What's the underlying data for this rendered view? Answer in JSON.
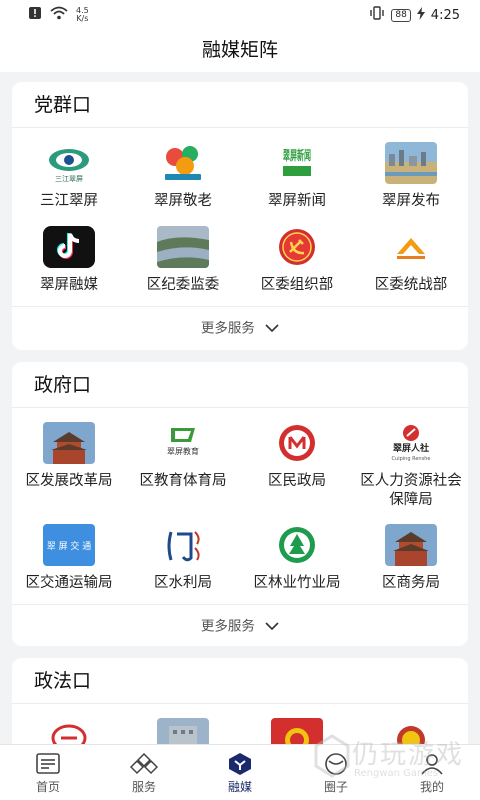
{
  "status": {
    "speed_value": "4.5",
    "speed_unit": "K/s",
    "battery": "88",
    "time": "4:25"
  },
  "header": {
    "title": "融媒矩阵"
  },
  "sections": [
    {
      "title": "党群口",
      "items": [
        {
          "label": "三江翠屏",
          "icon": "sanjiang-cuiping-logo"
        },
        {
          "label": "翠屏敬老",
          "icon": "cuiping-jinglao-logo"
        },
        {
          "label": "翠屏新闻",
          "icon": "cuiping-news-logo",
          "logo_text": "翠屏新闻"
        },
        {
          "label": "翠屏发布",
          "icon": "city-photo"
        },
        {
          "label": "翠屏融媒",
          "icon": "tiktok-logo"
        },
        {
          "label": "区纪委监委",
          "icon": "river-photo"
        },
        {
          "label": "区委组织部",
          "icon": "party-emblem"
        },
        {
          "label": "区委统战部",
          "icon": "united-front-logo"
        }
      ],
      "more": "更多服务"
    },
    {
      "title": "政府口",
      "items": [
        {
          "label": "区发展改革局",
          "icon": "tower-photo"
        },
        {
          "label": "区教育体育局",
          "icon": "education-logo",
          "logo_text": "翠屏教育"
        },
        {
          "label": "区民政局",
          "icon": "civil-affairs-emblem"
        },
        {
          "label": "区人力资源社会保障局",
          "icon": "hr-logo",
          "logo_text": "翠屏人社",
          "logo_sub": "Cuiping Renshe"
        },
        {
          "label": "区交通运输局",
          "icon": "transport-logo",
          "logo_text": "翠 屏 交 通"
        },
        {
          "label": "区水利局",
          "icon": "water-logo"
        },
        {
          "label": "区林业竹业局",
          "icon": "forestry-emblem"
        },
        {
          "label": "区商务局",
          "icon": "tower-photo"
        }
      ],
      "more": "更多服务"
    },
    {
      "title": "政法口",
      "items": [
        {
          "label": "",
          "icon": "law-logo"
        },
        {
          "label": "",
          "icon": "building-photo"
        },
        {
          "label": "",
          "icon": "national-emblem"
        },
        {
          "label": "",
          "icon": "court-emblem"
        }
      ]
    }
  ],
  "tabs": [
    {
      "label": "首页",
      "icon": "home-icon"
    },
    {
      "label": "服务",
      "icon": "services-icon"
    },
    {
      "label": "融媒",
      "icon": "media-icon",
      "active": true
    },
    {
      "label": "圈子",
      "icon": "circle-icon"
    },
    {
      "label": "我的",
      "icon": "profile-icon"
    }
  ],
  "watermark": {
    "text": "仍玩游戏",
    "sub": "Rengwan Games"
  }
}
